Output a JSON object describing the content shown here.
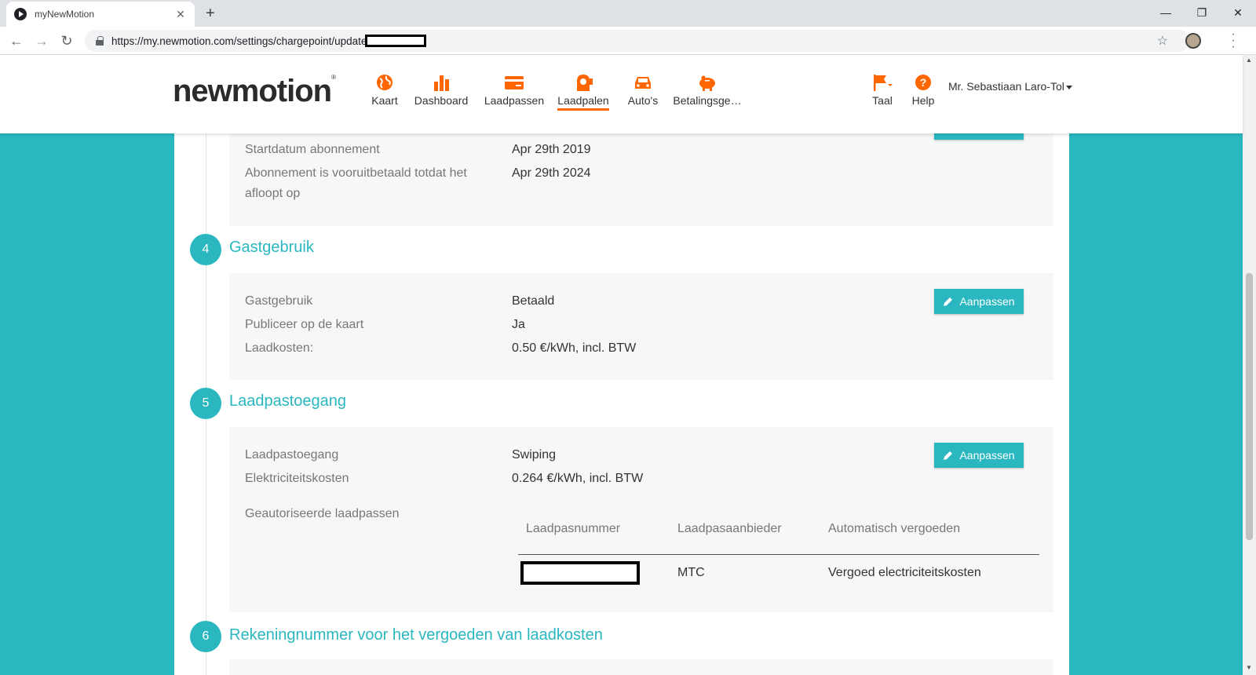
{
  "browser": {
    "tab_title": "myNewMotion",
    "new_tab": "+",
    "url": "https://my.newmotion.com/settings/chargepoint/update",
    "window_controls": [
      "minimize-icon",
      "restore-icon",
      "close-icon"
    ]
  },
  "header": {
    "logo": "newmotion",
    "nav": [
      {
        "label": "Kaart",
        "icon": "globe-icon"
      },
      {
        "label": "Dashboard",
        "icon": "bar-chart-icon"
      },
      {
        "label": "Laadpassen",
        "icon": "card-icon"
      },
      {
        "label": "Laadpalen",
        "icon": "charger-icon",
        "active": true
      },
      {
        "label": "Auto's",
        "icon": "car-icon"
      },
      {
        "label": "Betalingsge…",
        "icon": "piggy-bank-icon"
      }
    ],
    "language": {
      "label": "Taal",
      "icon": "flag-icon"
    },
    "help": {
      "label": "Help",
      "icon": "help-icon"
    },
    "user": "Mr. Sebastiaan Laro-Tol"
  },
  "subscription": {
    "rows": [
      {
        "label": "Startdatum abonnement",
        "value": "Apr 29th 2019"
      },
      {
        "label": "Abonnement is vooruitbetaald totdat het afloopt op",
        "value": "Apr 29th 2024"
      }
    ]
  },
  "sections": {
    "guest": {
      "number": "4",
      "title": "Gastgebruik",
      "edit_label": "Aanpassen",
      "rows": [
        {
          "label": "Gastgebruik",
          "value": "Betaald"
        },
        {
          "label": "Publiceer op de kaart",
          "value": "Ja"
        },
        {
          "label": "Laadkosten:",
          "value": "0.50 €/kWh, incl. BTW"
        }
      ]
    },
    "card_access": {
      "number": "5",
      "title": "Laadpastoegang",
      "edit_label": "Aanpassen",
      "rows": [
        {
          "label": "Laadpastoegang",
          "value": "Swiping"
        },
        {
          "label": "Elektriciteitskosten",
          "value": "0.264 €/kWh, incl. BTW"
        }
      ],
      "authorized_label": "Geautoriseerde laadpassen",
      "table": {
        "headers": [
          "Laadpasnummer",
          "Laadpasaanbieder",
          "Automatisch vergoeden"
        ],
        "rows": [
          {
            "card_number": "",
            "provider": "MTC",
            "reimburse": "Vergoed electriciteitskosten"
          }
        ]
      }
    },
    "bank": {
      "number": "6",
      "title": "Rekeningnummer voor het vergoeden van laadkosten"
    }
  },
  "colors": {
    "teal": "#2ab7bf",
    "orange": "#ff6600"
  }
}
